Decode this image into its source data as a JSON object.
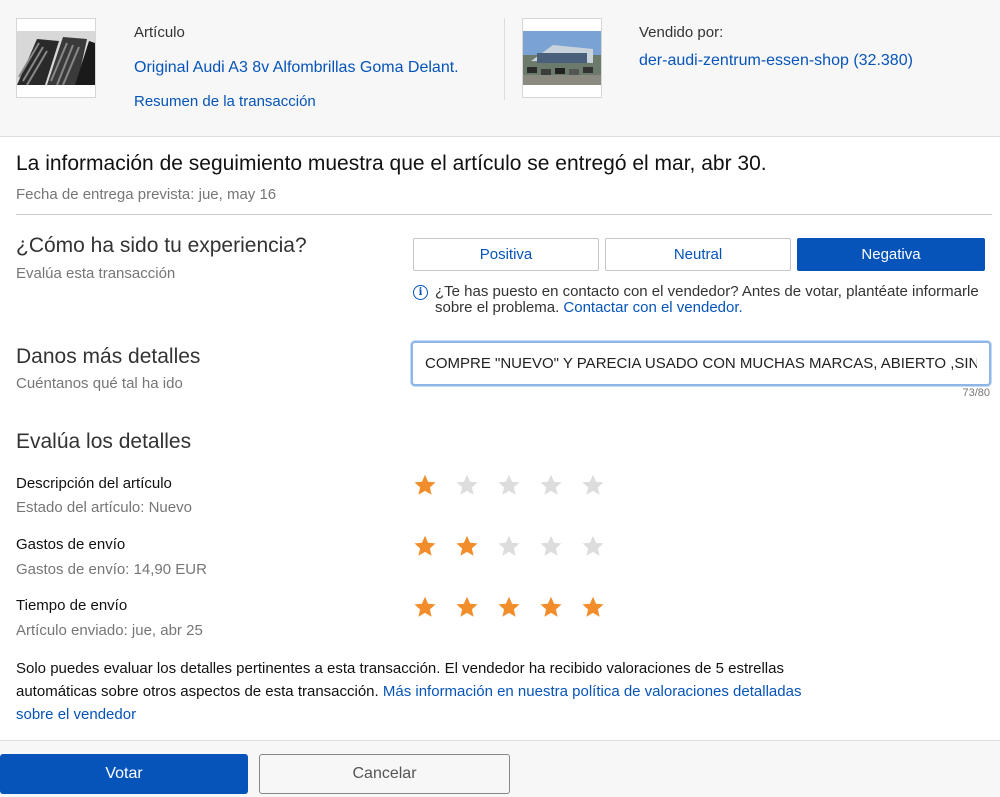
{
  "header": {
    "item_label": "Artículo",
    "item_title": "Original Audi A3 8v Alfombrillas Goma Delant.",
    "summary_link": "Resumen de la transacción",
    "seller_label": "Vendido por:",
    "seller_name": "der-audi-zentrum-essen-shop (32.380)"
  },
  "tracking": {
    "message": "La información de seguimiento muestra que el artículo se entregó el mar, abr 30.",
    "expected": "Fecha de entrega prevista: jue, may 16"
  },
  "experience": {
    "title": "¿Cómo ha sido tu experiencia?",
    "subtitle": "Evalúa esta transacción",
    "options": [
      "Positiva",
      "Neutral",
      "Negativa"
    ],
    "selected": "Negativa",
    "info_text": "¿Te has puesto en contacto con el vendedor? Antes de votar, plantéate informarle sobre el problema.",
    "contact_link": "Contactar con el vendedor."
  },
  "details": {
    "title": "Danos más detalles",
    "subtitle": "Cuéntanos qué tal ha ido",
    "value": "COMPRE \"NUEVO\" Y PARECIA USADO CON MUCHAS MARCAS, ABIERTO ,SIN PROTEC",
    "counter": "73/80"
  },
  "ratings": {
    "title": "Evalúa los detalles",
    "items": [
      {
        "label": "Descripción del artículo",
        "sub": "Estado del artículo: Nuevo",
        "stars": 1
      },
      {
        "label": "Gastos de envío",
        "sub": "Gastos de envío: 14,90 EUR",
        "stars": 2
      },
      {
        "label": "Tiempo de envío",
        "sub": "Artículo enviado: jue, abr 25",
        "stars": 5
      }
    ],
    "star_filled_color": "#f18e2b",
    "star_empty_color": "#dddddd"
  },
  "note": {
    "text": "Solo puedes evaluar los detalles pertinentes a esta transacción. El vendedor ha recibido valoraciones de 5 estrellas automáticas sobre otros aspectos de esta transacción. ",
    "link": "Más información en nuestra política de valoraciones detalladas sobre el vendedor"
  },
  "footer": {
    "submit_label": "Votar",
    "cancel_label": "Cancelar"
  }
}
